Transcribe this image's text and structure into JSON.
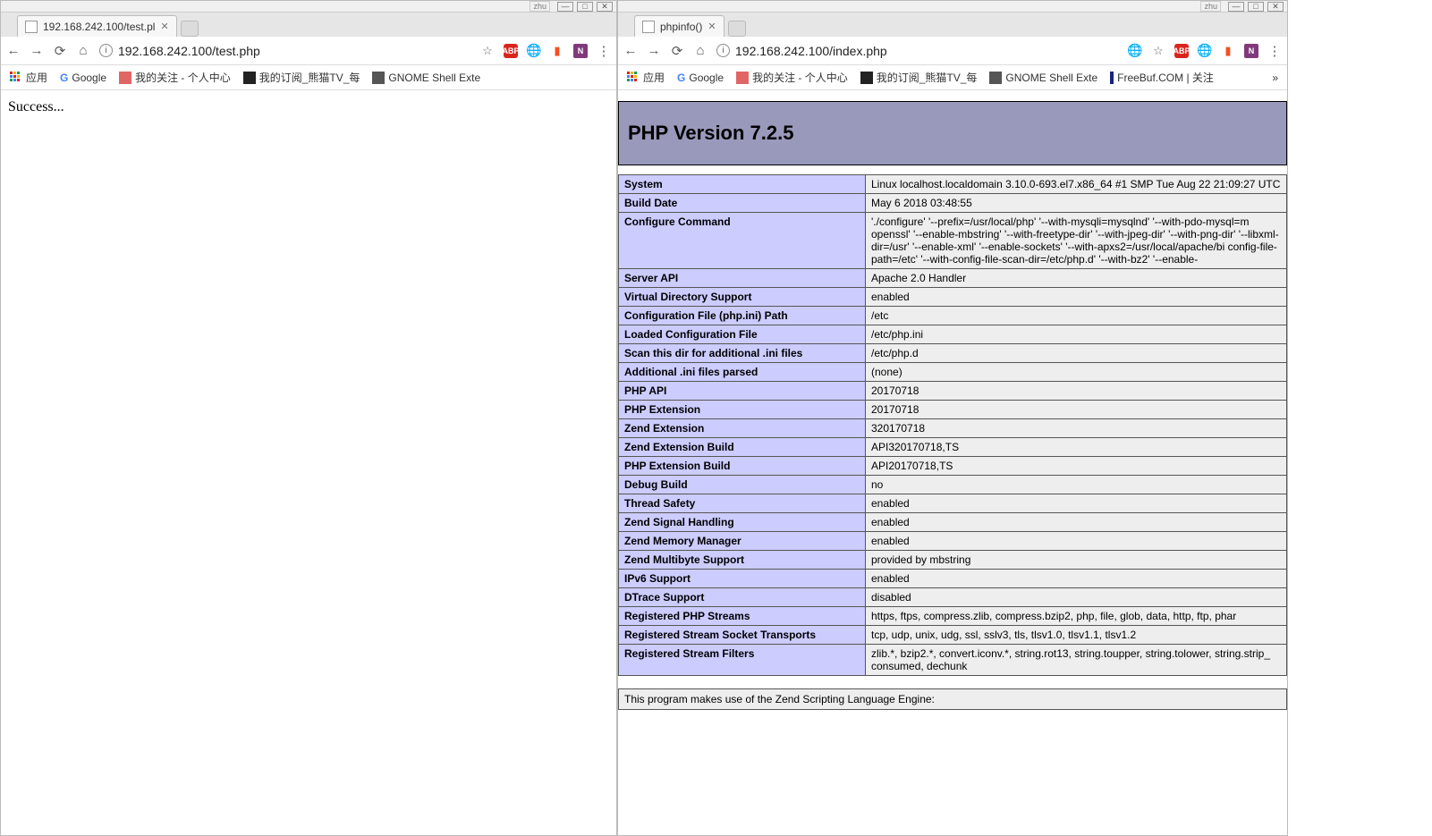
{
  "watermark": "",
  "left": {
    "titlebar_tag": "zhu",
    "tab_title": "192.168.242.100/test.pl",
    "url": "192.168.242.100/test.php",
    "bookmarks": {
      "apps": "应用",
      "google": "Google",
      "mygz": "我的关注 - 个人中心",
      "panda": "我的订阅_熊猫TV_每",
      "gnome": "GNOME Shell Exte"
    },
    "body": "Success..."
  },
  "right": {
    "titlebar_tag": "zhu",
    "tab_title": "phpinfo()",
    "url": "192.168.242.100/index.php",
    "bookmarks": {
      "apps": "应用",
      "google": "Google",
      "mygz": "我的关注 - 个人中心",
      "panda": "我的订阅_熊猫TV_每",
      "gnome": "GNOME Shell Exte",
      "freebuf": "FreeBuf.COM | 关注"
    },
    "php_title": "PHP Version 7.2.5",
    "rows": [
      {
        "k": "System",
        "v": "Linux localhost.localdomain 3.10.0-693.el7.x86_64 #1 SMP Tue Aug 22 21:09:27 UTC"
      },
      {
        "k": "Build Date",
        "v": "May 6 2018 03:48:55"
      },
      {
        "k": "Configure Command",
        "v": "'./configure' '--prefix=/usr/local/php' '--with-mysqli=mysqlnd' '--with-pdo-mysql=m  openssl' '--enable-mbstring' '--with-freetype-dir' '--with-jpeg-dir' '--with-png-dir' '--libxml-dir=/usr' '--enable-xml' '--enable-sockets' '--with-apxs2=/usr/local/apache/bi  config-file-path=/etc' '--with-config-file-scan-dir=/etc/php.d' '--with-bz2' '--enable-"
      },
      {
        "k": "Server API",
        "v": "Apache 2.0 Handler"
      },
      {
        "k": "Virtual Directory Support",
        "v": "enabled"
      },
      {
        "k": "Configuration File (php.ini) Path",
        "v": "/etc"
      },
      {
        "k": "Loaded Configuration File",
        "v": "/etc/php.ini"
      },
      {
        "k": "Scan this dir for additional .ini files",
        "v": "/etc/php.d"
      },
      {
        "k": "Additional .ini files parsed",
        "v": "(none)"
      },
      {
        "k": "PHP API",
        "v": "20170718"
      },
      {
        "k": "PHP Extension",
        "v": "20170718"
      },
      {
        "k": "Zend Extension",
        "v": "320170718"
      },
      {
        "k": "Zend Extension Build",
        "v": "API320170718,TS"
      },
      {
        "k": "PHP Extension Build",
        "v": "API20170718,TS"
      },
      {
        "k": "Debug Build",
        "v": "no"
      },
      {
        "k": "Thread Safety",
        "v": "enabled"
      },
      {
        "k": "Zend Signal Handling",
        "v": "enabled"
      },
      {
        "k": "Zend Memory Manager",
        "v": "enabled"
      },
      {
        "k": "Zend Multibyte Support",
        "v": "provided by mbstring"
      },
      {
        "k": "IPv6 Support",
        "v": "enabled"
      },
      {
        "k": "DTrace Support",
        "v": "disabled"
      },
      {
        "k": "Registered PHP Streams",
        "v": "https, ftps, compress.zlib, compress.bzip2, php, file, glob, data, http, ftp, phar"
      },
      {
        "k": "Registered Stream Socket Transports",
        "v": "tcp, udp, unix, udg, ssl, sslv3, tls, tlsv1.0, tlsv1.1, tlsv1.2"
      },
      {
        "k": "Registered Stream Filters",
        "v": "zlib.*, bzip2.*, convert.iconv.*, string.rot13, string.toupper, string.tolower, string.strip_  consumed, dechunk"
      }
    ],
    "zend_note": "This program makes use of the Zend Scripting Language Engine:"
  }
}
